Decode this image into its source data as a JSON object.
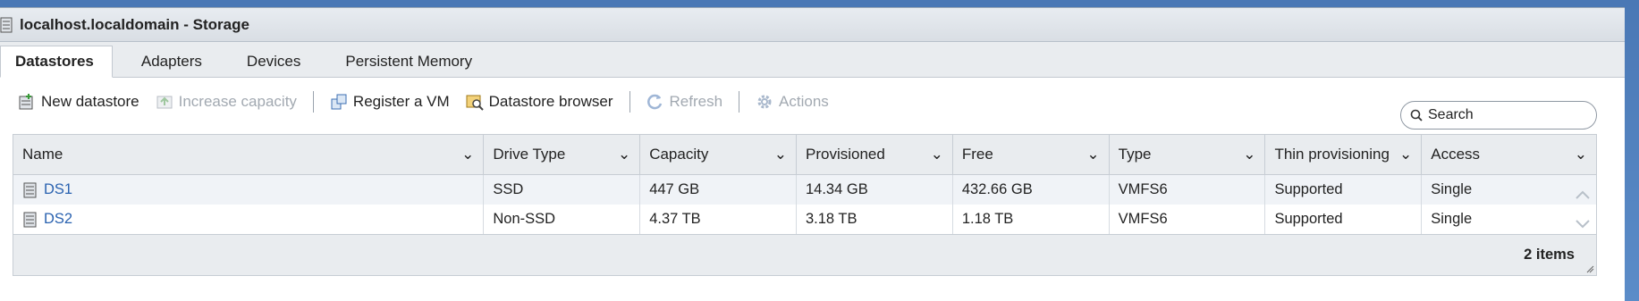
{
  "window": {
    "title": "localhost.localdomain - Storage"
  },
  "tabs": [
    {
      "label": "Datastores",
      "active": true
    },
    {
      "label": "Adapters"
    },
    {
      "label": "Devices"
    },
    {
      "label": "Persistent Memory"
    }
  ],
  "toolbar": {
    "new_datastore": "New datastore",
    "increase_capacity": "Increase capacity",
    "register_vm": "Register a VM",
    "datastore_browser": "Datastore browser",
    "refresh": "Refresh",
    "actions": "Actions"
  },
  "search": {
    "placeholder": "Search"
  },
  "table": {
    "columns": [
      "Name",
      "Drive Type",
      "Capacity",
      "Provisioned",
      "Free",
      "Type",
      "Thin provisioning",
      "Access"
    ],
    "rows": [
      [
        "DS1",
        "SSD",
        "447 GB",
        "14.34 GB",
        "432.66 GB",
        "VMFS6",
        "Supported",
        "Single"
      ],
      [
        "DS2",
        "Non-SSD",
        "4.37 TB",
        "3.18 TB",
        "1.18 TB",
        "VMFS6",
        "Supported",
        "Single"
      ]
    ],
    "footer": "2 items"
  },
  "colors": {
    "accent_link": "#2a62b0",
    "desktop": "#4a78b5"
  }
}
